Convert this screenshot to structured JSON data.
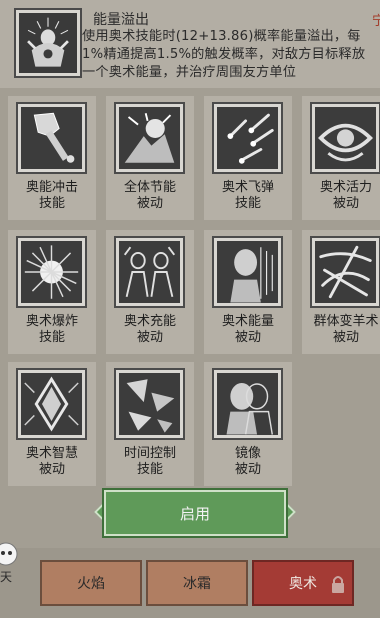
{
  "detail": {
    "title": "能量溢出",
    "description": "使用奥术技能时(12+13.86)概率能量溢出，每1%精通提高1.5%的触发概率，对敌方目标释放一个奥术能量，并治疗周围友方单位",
    "tag": "宁",
    "icon": "arcane-overflow-icon"
  },
  "skills": [
    {
      "name": "奥能冲击",
      "kind": "技能",
      "icon": "arcane-staff-icon"
    },
    {
      "name": "全体节能",
      "kind": "被动",
      "icon": "energy-save-icon"
    },
    {
      "name": "奥术飞弹",
      "kind": "技能",
      "icon": "arcane-missiles-icon"
    },
    {
      "name": "奥术活力",
      "kind": "被动",
      "icon": "arcane-eye-icon"
    },
    {
      "name": "奥术爆炸",
      "kind": "技能",
      "icon": "arcane-explosion-icon"
    },
    {
      "name": "奥术充能",
      "kind": "被动",
      "icon": "arcane-charge-icon"
    },
    {
      "name": "奥术能量",
      "kind": "被动",
      "icon": "arcane-energy-icon"
    },
    {
      "name": "群体变羊术",
      "kind": "被动",
      "icon": "mass-polymorph-icon"
    },
    {
      "name": "奥术智慧",
      "kind": "被动",
      "icon": "arcane-wisdom-icon"
    },
    {
      "name": "时间控制",
      "kind": "技能",
      "icon": "time-control-icon"
    },
    {
      "name": "镜像",
      "kind": "被动",
      "icon": "mirror-image-icon"
    }
  ],
  "enable_label": "启用",
  "tabs": [
    {
      "label": "火焰",
      "active": false
    },
    {
      "label": "冰霜",
      "active": false
    },
    {
      "label": "奥术",
      "active": true
    }
  ],
  "side_label": "天"
}
